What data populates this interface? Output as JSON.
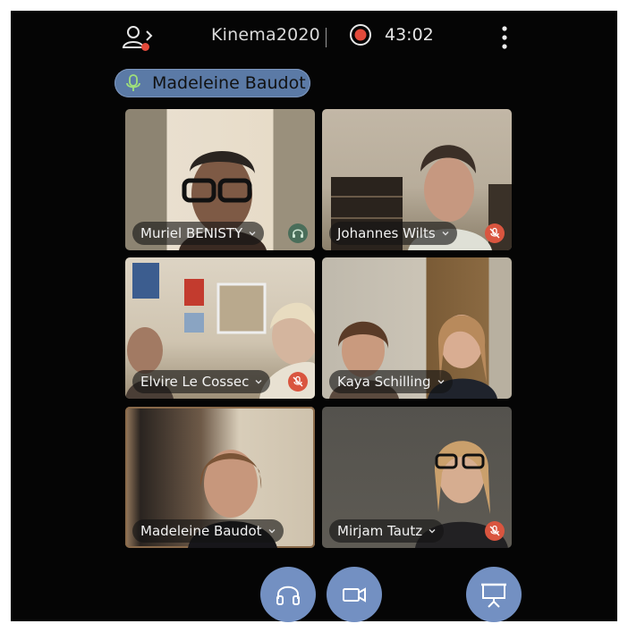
{
  "header": {
    "room_name": "Kinema2020",
    "timer": "43:02"
  },
  "active_speaker": {
    "name": "Madeleine Baudot"
  },
  "participants": [
    {
      "name": "Muriel BENISTY",
      "status": "listen-only"
    },
    {
      "name": "Johannes Wilts",
      "status": "muted"
    },
    {
      "name": "Elvire Le Cossec",
      "status": "muted"
    },
    {
      "name": "Kaya Schilling",
      "status": ""
    },
    {
      "name": "Madeleine Baudot",
      "status": ""
    },
    {
      "name": "Mirjam Tautz",
      "status": "muted"
    }
  ],
  "colors": {
    "accent": "#7390c2",
    "record": "#e24a3b",
    "muted": "#d9553f"
  },
  "icons": [
    "users-icon",
    "record-icon",
    "more-icon",
    "microphone-icon",
    "headphones-icon",
    "camera-icon",
    "screen-share-icon",
    "mic-off-icon",
    "chevron-down-icon"
  ]
}
